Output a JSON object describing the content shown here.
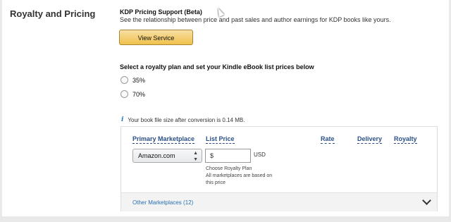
{
  "section": {
    "title": "Royalty and Pricing"
  },
  "kdp": {
    "title": "KDP Pricing Support (Beta)",
    "description": "See the relationship between price and past sales and author earnings for KDP books like yours.",
    "button_label": "View Service"
  },
  "royalty": {
    "heading": "Select a royalty plan and set your Kindle eBook list prices below",
    "options": [
      {
        "label": "35%",
        "selected": false
      },
      {
        "label": "70%",
        "selected": false
      }
    ]
  },
  "info": {
    "icon": "info-icon",
    "text": "Your book file size after conversion is 0.14 MB."
  },
  "pricing_table": {
    "headers": {
      "marketplace": "Primary Marketplace",
      "list_price": "List Price",
      "rate": "Rate",
      "delivery": "Delivery",
      "royalty": "Royalty"
    },
    "marketplace_selected": "Amazon.com",
    "price_placeholder": "$",
    "currency": "USD",
    "note_line1": "Choose Royalty Plan",
    "note_line2": "All marketplaces are based on",
    "note_line3": "this price",
    "other_marketplaces": "Other Marketplaces (12)"
  },
  "colors": {
    "accent_link": "#2a6fb3",
    "button_yellow": "#f0c14b"
  }
}
